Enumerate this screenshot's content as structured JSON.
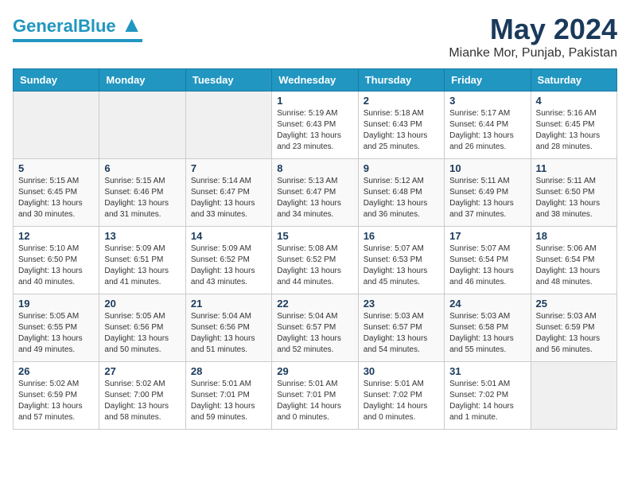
{
  "header": {
    "logo_general": "General",
    "logo_blue": "Blue",
    "month": "May 2024",
    "location": "Mianke Mor, Punjab, Pakistan"
  },
  "days_of_week": [
    "Sunday",
    "Monday",
    "Tuesday",
    "Wednesday",
    "Thursday",
    "Friday",
    "Saturday"
  ],
  "weeks": [
    [
      {
        "day": "",
        "sunrise": "",
        "sunset": "",
        "daylight": ""
      },
      {
        "day": "",
        "sunrise": "",
        "sunset": "",
        "daylight": ""
      },
      {
        "day": "",
        "sunrise": "",
        "sunset": "",
        "daylight": ""
      },
      {
        "day": "1",
        "sunrise": "Sunrise: 5:19 AM",
        "sunset": "Sunset: 6:43 PM",
        "daylight": "Daylight: 13 hours and 23 minutes."
      },
      {
        "day": "2",
        "sunrise": "Sunrise: 5:18 AM",
        "sunset": "Sunset: 6:43 PM",
        "daylight": "Daylight: 13 hours and 25 minutes."
      },
      {
        "day": "3",
        "sunrise": "Sunrise: 5:17 AM",
        "sunset": "Sunset: 6:44 PM",
        "daylight": "Daylight: 13 hours and 26 minutes."
      },
      {
        "day": "4",
        "sunrise": "Sunrise: 5:16 AM",
        "sunset": "Sunset: 6:45 PM",
        "daylight": "Daylight: 13 hours and 28 minutes."
      }
    ],
    [
      {
        "day": "5",
        "sunrise": "Sunrise: 5:15 AM",
        "sunset": "Sunset: 6:45 PM",
        "daylight": "Daylight: 13 hours and 30 minutes."
      },
      {
        "day": "6",
        "sunrise": "Sunrise: 5:15 AM",
        "sunset": "Sunset: 6:46 PM",
        "daylight": "Daylight: 13 hours and 31 minutes."
      },
      {
        "day": "7",
        "sunrise": "Sunrise: 5:14 AM",
        "sunset": "Sunset: 6:47 PM",
        "daylight": "Daylight: 13 hours and 33 minutes."
      },
      {
        "day": "8",
        "sunrise": "Sunrise: 5:13 AM",
        "sunset": "Sunset: 6:47 PM",
        "daylight": "Daylight: 13 hours and 34 minutes."
      },
      {
        "day": "9",
        "sunrise": "Sunrise: 5:12 AM",
        "sunset": "Sunset: 6:48 PM",
        "daylight": "Daylight: 13 hours and 36 minutes."
      },
      {
        "day": "10",
        "sunrise": "Sunrise: 5:11 AM",
        "sunset": "Sunset: 6:49 PM",
        "daylight": "Daylight: 13 hours and 37 minutes."
      },
      {
        "day": "11",
        "sunrise": "Sunrise: 5:11 AM",
        "sunset": "Sunset: 6:50 PM",
        "daylight": "Daylight: 13 hours and 38 minutes."
      }
    ],
    [
      {
        "day": "12",
        "sunrise": "Sunrise: 5:10 AM",
        "sunset": "Sunset: 6:50 PM",
        "daylight": "Daylight: 13 hours and 40 minutes."
      },
      {
        "day": "13",
        "sunrise": "Sunrise: 5:09 AM",
        "sunset": "Sunset: 6:51 PM",
        "daylight": "Daylight: 13 hours and 41 minutes."
      },
      {
        "day": "14",
        "sunrise": "Sunrise: 5:09 AM",
        "sunset": "Sunset: 6:52 PM",
        "daylight": "Daylight: 13 hours and 43 minutes."
      },
      {
        "day": "15",
        "sunrise": "Sunrise: 5:08 AM",
        "sunset": "Sunset: 6:52 PM",
        "daylight": "Daylight: 13 hours and 44 minutes."
      },
      {
        "day": "16",
        "sunrise": "Sunrise: 5:07 AM",
        "sunset": "Sunset: 6:53 PM",
        "daylight": "Daylight: 13 hours and 45 minutes."
      },
      {
        "day": "17",
        "sunrise": "Sunrise: 5:07 AM",
        "sunset": "Sunset: 6:54 PM",
        "daylight": "Daylight: 13 hours and 46 minutes."
      },
      {
        "day": "18",
        "sunrise": "Sunrise: 5:06 AM",
        "sunset": "Sunset: 6:54 PM",
        "daylight": "Daylight: 13 hours and 48 minutes."
      }
    ],
    [
      {
        "day": "19",
        "sunrise": "Sunrise: 5:05 AM",
        "sunset": "Sunset: 6:55 PM",
        "daylight": "Daylight: 13 hours and 49 minutes."
      },
      {
        "day": "20",
        "sunrise": "Sunrise: 5:05 AM",
        "sunset": "Sunset: 6:56 PM",
        "daylight": "Daylight: 13 hours and 50 minutes."
      },
      {
        "day": "21",
        "sunrise": "Sunrise: 5:04 AM",
        "sunset": "Sunset: 6:56 PM",
        "daylight": "Daylight: 13 hours and 51 minutes."
      },
      {
        "day": "22",
        "sunrise": "Sunrise: 5:04 AM",
        "sunset": "Sunset: 6:57 PM",
        "daylight": "Daylight: 13 hours and 52 minutes."
      },
      {
        "day": "23",
        "sunrise": "Sunrise: 5:03 AM",
        "sunset": "Sunset: 6:57 PM",
        "daylight": "Daylight: 13 hours and 54 minutes."
      },
      {
        "day": "24",
        "sunrise": "Sunrise: 5:03 AM",
        "sunset": "Sunset: 6:58 PM",
        "daylight": "Daylight: 13 hours and 55 minutes."
      },
      {
        "day": "25",
        "sunrise": "Sunrise: 5:03 AM",
        "sunset": "Sunset: 6:59 PM",
        "daylight": "Daylight: 13 hours and 56 minutes."
      }
    ],
    [
      {
        "day": "26",
        "sunrise": "Sunrise: 5:02 AM",
        "sunset": "Sunset: 6:59 PM",
        "daylight": "Daylight: 13 hours and 57 minutes."
      },
      {
        "day": "27",
        "sunrise": "Sunrise: 5:02 AM",
        "sunset": "Sunset: 7:00 PM",
        "daylight": "Daylight: 13 hours and 58 minutes."
      },
      {
        "day": "28",
        "sunrise": "Sunrise: 5:01 AM",
        "sunset": "Sunset: 7:01 PM",
        "daylight": "Daylight: 13 hours and 59 minutes."
      },
      {
        "day": "29",
        "sunrise": "Sunrise: 5:01 AM",
        "sunset": "Sunset: 7:01 PM",
        "daylight": "Daylight: 14 hours and 0 minutes."
      },
      {
        "day": "30",
        "sunrise": "Sunrise: 5:01 AM",
        "sunset": "Sunset: 7:02 PM",
        "daylight": "Daylight: 14 hours and 0 minutes."
      },
      {
        "day": "31",
        "sunrise": "Sunrise: 5:01 AM",
        "sunset": "Sunset: 7:02 PM",
        "daylight": "Daylight: 14 hours and 1 minute."
      },
      {
        "day": "",
        "sunrise": "",
        "sunset": "",
        "daylight": ""
      }
    ]
  ]
}
